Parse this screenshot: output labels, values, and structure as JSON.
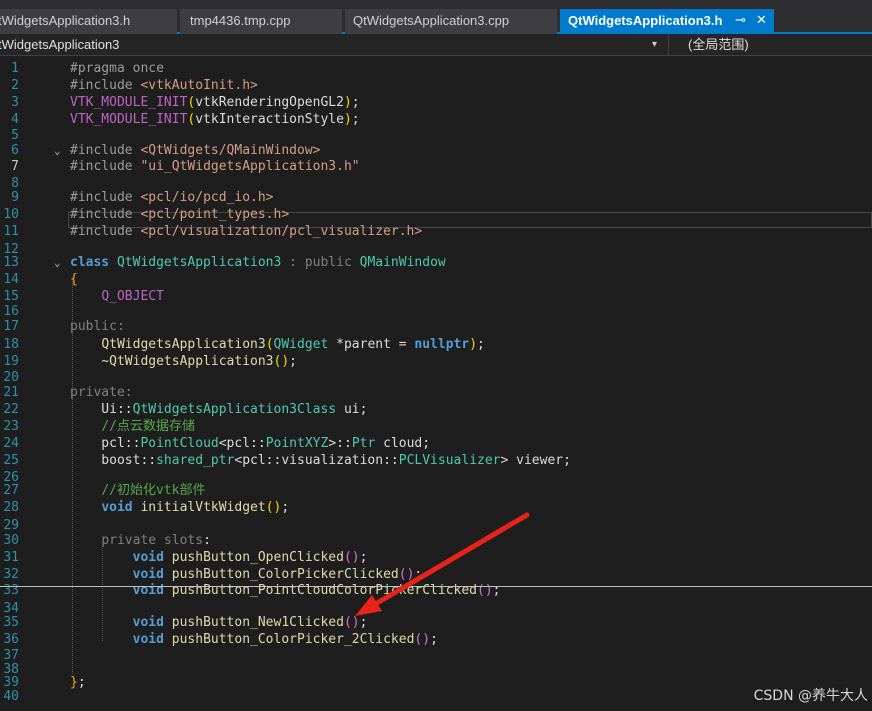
{
  "tabs": [
    {
      "label": "tWidgetsApplication3.h",
      "active": false
    },
    {
      "label": "tmp4436.tmp.cpp",
      "active": false
    },
    {
      "label": "QtWidgetsApplication3.cpp",
      "active": false
    },
    {
      "label": "QtWidgetsApplication3.h",
      "active": true,
      "pin_icon": "⊸",
      "close_icon": "✕"
    }
  ],
  "navbar": {
    "class_scope": "tWidgetsApplication3",
    "dropdown_icon": "▾",
    "global_scope": "(全局范围)"
  },
  "code_lines": [
    {
      "n": "1",
      "fold": "",
      "tokens": [
        [
          "pp",
          "#pragma once"
        ]
      ]
    },
    {
      "n": "2",
      "fold": "",
      "tokens": [
        [
          "pp",
          "#include "
        ],
        [
          "str",
          "<vtkAutoInit.h>"
        ]
      ]
    },
    {
      "n": "3",
      "fold": "",
      "tokens": [
        [
          "mac",
          "VTK_MODULE_INIT"
        ],
        [
          "p1",
          "("
        ],
        [
          "plain",
          "vtkRenderingOpenGL2"
        ],
        [
          "p1",
          ")"
        ],
        [
          "plain",
          ";"
        ]
      ]
    },
    {
      "n": "4",
      "fold": "",
      "tokens": [
        [
          "mac",
          "VTK_MODULE_INIT"
        ],
        [
          "p1",
          "("
        ],
        [
          "plain",
          "vtkInteractionStyle"
        ],
        [
          "p1",
          ")"
        ],
        [
          "plain",
          ";"
        ]
      ]
    },
    {
      "n": "5",
      "fold": "",
      "tokens": []
    },
    {
      "n": "6",
      "fold": "⌄",
      "tokens": [
        [
          "pp",
          "#include "
        ],
        [
          "str",
          "<QtWidgets/QMainWindow>"
        ]
      ]
    },
    {
      "n": "7",
      "fold": "",
      "tokens": [
        [
          "pp",
          "#include "
        ],
        [
          "str",
          "\"ui_QtWidgetsApplication3.h\""
        ]
      ],
      "current": true
    },
    {
      "n": "8",
      "fold": "",
      "tokens": []
    },
    {
      "n": "9",
      "fold": "",
      "tokens": [
        [
          "pp",
          "#include "
        ],
        [
          "str",
          "<pcl/io/pcd_io.h>"
        ]
      ]
    },
    {
      "n": "10",
      "fold": "",
      "tokens": [
        [
          "pp",
          "#include "
        ],
        [
          "str",
          "<pcl/point_types.h>"
        ]
      ]
    },
    {
      "n": "11",
      "fold": "",
      "tokens": [
        [
          "pp",
          "#include "
        ],
        [
          "str",
          "<pcl/visualization/pcl_visualizer.h>"
        ]
      ]
    },
    {
      "n": "12",
      "fold": "",
      "tokens": []
    },
    {
      "n": "13",
      "fold": "⌄",
      "tokens": [
        [
          "kw",
          "class"
        ],
        [
          "plain",
          " "
        ],
        [
          "type",
          "QtWidgetsApplication3"
        ],
        [
          "plain",
          " "
        ],
        [
          "kw2",
          ": public"
        ],
        [
          "plain",
          " "
        ],
        [
          "type",
          "QMainWindow"
        ]
      ]
    },
    {
      "n": "14",
      "fold": "",
      "tokens": [
        [
          "brace",
          "{"
        ]
      ]
    },
    {
      "n": "15",
      "fold": "",
      "tokens": [
        [
          "plain",
          "    "
        ],
        [
          "mac",
          "Q_OBJECT"
        ]
      ]
    },
    {
      "n": "16",
      "fold": "",
      "tokens": []
    },
    {
      "n": "17",
      "fold": "",
      "tokens": [
        [
          "kw2",
          "public:"
        ]
      ]
    },
    {
      "n": "18",
      "fold": "",
      "tokens": [
        [
          "plain",
          "    "
        ],
        [
          "fn",
          "QtWidgetsApplication3"
        ],
        [
          "p1",
          "("
        ],
        [
          "type",
          "QWidget"
        ],
        [
          "plain",
          " *parent = "
        ],
        [
          "kw",
          "nullptr"
        ],
        [
          "p1",
          ")"
        ],
        [
          "plain",
          ";"
        ]
      ]
    },
    {
      "n": "19",
      "fold": "",
      "tokens": [
        [
          "plain",
          "    "
        ],
        [
          "fn",
          "~QtWidgetsApplication3"
        ],
        [
          "p1",
          "()"
        ],
        [
          "plain",
          ";"
        ]
      ]
    },
    {
      "n": "20",
      "fold": "",
      "tokens": []
    },
    {
      "n": "21",
      "fold": "",
      "tokens": [
        [
          "kw2",
          "private:"
        ]
      ]
    },
    {
      "n": "22",
      "fold": "",
      "tokens": [
        [
          "plain",
          "    Ui::"
        ],
        [
          "type",
          "QtWidgetsApplication3Class"
        ],
        [
          "plain",
          " ui;"
        ]
      ]
    },
    {
      "n": "23",
      "fold": "",
      "tokens": [
        [
          "plain",
          "    "
        ],
        [
          "cm",
          "//点云数据存储"
        ]
      ]
    },
    {
      "n": "24",
      "fold": "",
      "tokens": [
        [
          "plain",
          "    pcl::"
        ],
        [
          "type",
          "PointCloud"
        ],
        [
          "plain",
          "<pcl::"
        ],
        [
          "type",
          "PointXYZ"
        ],
        [
          "plain",
          ">::"
        ],
        [
          "type",
          "Ptr"
        ],
        [
          "plain",
          " cloud;"
        ]
      ]
    },
    {
      "n": "25",
      "fold": "",
      "tokens": [
        [
          "plain",
          "    boost::"
        ],
        [
          "type",
          "shared_ptr"
        ],
        [
          "plain",
          "<pcl::visualization::"
        ],
        [
          "type",
          "PCLVisualizer"
        ],
        [
          "plain",
          "> viewer;"
        ]
      ]
    },
    {
      "n": "26",
      "fold": "",
      "tokens": []
    },
    {
      "n": "27",
      "fold": "",
      "tokens": [
        [
          "plain",
          "    "
        ],
        [
          "cm",
          "//初始化vtk部件"
        ]
      ]
    },
    {
      "n": "28",
      "fold": "",
      "tokens": [
        [
          "plain",
          "    "
        ],
        [
          "kw",
          "void"
        ],
        [
          "plain",
          " "
        ],
        [
          "fn",
          "initialVtkWidget"
        ],
        [
          "p1",
          "()"
        ],
        [
          "plain",
          ";"
        ]
      ]
    },
    {
      "n": "29",
      "fold": "",
      "tokens": []
    },
    {
      "n": "30",
      "fold": "",
      "tokens": [
        [
          "plain",
          "    "
        ],
        [
          "kw2",
          "private"
        ],
        [
          "plain",
          " "
        ],
        [
          "kw2",
          "slots"
        ],
        [
          "plain",
          ":"
        ]
      ]
    },
    {
      "n": "31",
      "fold": "",
      "tokens": [
        [
          "plain",
          "        "
        ],
        [
          "kw",
          "void"
        ],
        [
          "plain",
          " "
        ],
        [
          "fn",
          "pushButton_OpenClicked"
        ],
        [
          "p2",
          "()"
        ],
        [
          "plain",
          ";"
        ]
      ]
    },
    {
      "n": "32",
      "fold": "",
      "tokens": [
        [
          "plain",
          "        "
        ],
        [
          "kw",
          "void"
        ],
        [
          "plain",
          " "
        ],
        [
          "fn",
          "pushButton_ColorPickerClicked"
        ],
        [
          "p2",
          "()"
        ],
        [
          "plain",
          ";"
        ]
      ]
    },
    {
      "n": "33",
      "fold": "",
      "tokens": [
        [
          "plain",
          "        "
        ],
        [
          "kw",
          "void"
        ],
        [
          "plain",
          " "
        ],
        [
          "fn",
          "pushButton_PointCloudColorPickerClicked"
        ],
        [
          "p2",
          "()"
        ],
        [
          "plain",
          ";"
        ]
      ]
    },
    {
      "n": "34",
      "fold": "",
      "tokens": []
    },
    {
      "n": "35",
      "fold": "",
      "tokens": [
        [
          "plain",
          "        "
        ],
        [
          "kw",
          "void"
        ],
        [
          "plain",
          " "
        ],
        [
          "fn",
          "pushButton_New1Clicked"
        ],
        [
          "p2",
          "()"
        ],
        [
          "plain",
          ";"
        ]
      ]
    },
    {
      "n": "36",
      "fold": "",
      "tokens": [
        [
          "plain",
          "        "
        ],
        [
          "kw",
          "void"
        ],
        [
          "plain",
          " "
        ],
        [
          "fn",
          "pushButton_ColorPicker_2Clicked"
        ],
        [
          "p2",
          "()"
        ],
        [
          "plain",
          ";"
        ]
      ]
    },
    {
      "n": "37",
      "fold": "",
      "tokens": []
    },
    {
      "n": "38",
      "fold": "",
      "tokens": []
    },
    {
      "n": "39",
      "fold": "",
      "tokens": [
        [
          "brace",
          "}"
        ],
        [
          "plain",
          ";"
        ]
      ]
    },
    {
      "n": "40",
      "fold": "",
      "tokens": []
    }
  ],
  "colors": {
    "editor_bg": "#1e1e1e",
    "accent": "#007acc",
    "arrow": "#e8231a"
  },
  "watermark": "CSDN @养牛大人"
}
